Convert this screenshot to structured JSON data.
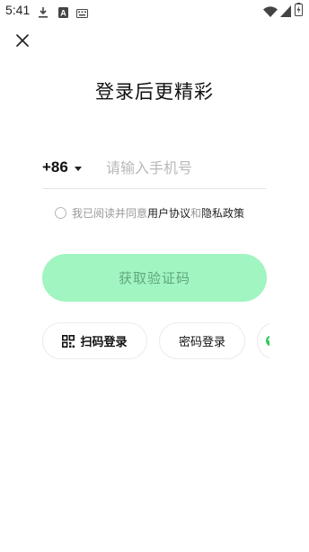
{
  "status_bar": {
    "time": "5:41",
    "icons_left": [
      "download-icon",
      "font-a-icon",
      "keyboard-icon"
    ],
    "icons_right": [
      "wifi-icon",
      "signal-icon",
      "battery-charging-icon"
    ]
  },
  "header": {
    "close_icon": "close-icon"
  },
  "main": {
    "title": "登录后更精彩",
    "country_code": "+86",
    "phone_placeholder": "请输入手机号",
    "phone_value": "",
    "agreement": {
      "checked": false,
      "prefix": "我已阅读并同意",
      "user_agreement": "用户协议",
      "and": "和",
      "privacy_policy": "隐私政策"
    },
    "get_code_button": "获取验证码"
  },
  "alt_login": {
    "qr_label": "扫码登录",
    "password_label": "密码登录",
    "more_icon": "green-bubble-icon"
  },
  "colors": {
    "accent_disabled": "#a0f5c0",
    "accent_text": "#62a87d",
    "background": "#ffffff"
  }
}
